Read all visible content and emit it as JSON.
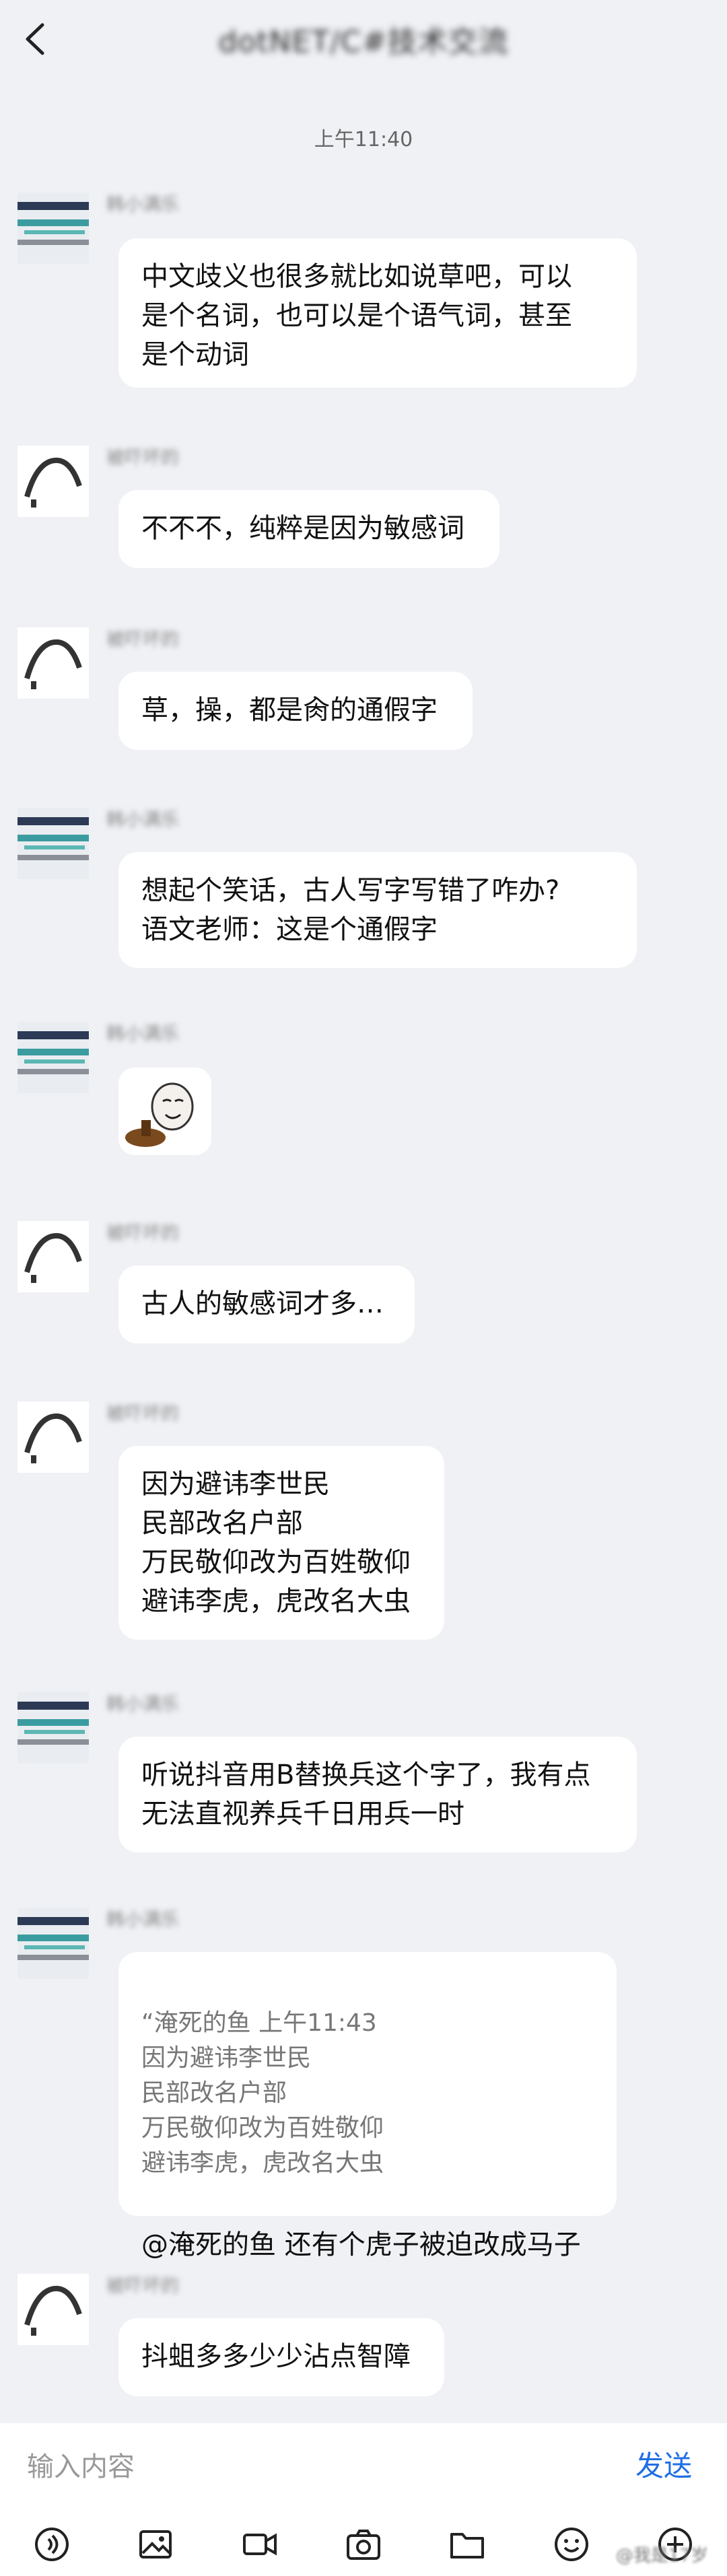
{
  "header": {
    "title": "dotNET/C#技术交流"
  },
  "time_divider": "上午11:40",
  "messages": [
    {
      "text": "中文歧义也很多就比如说草吧，可以\n是个名词，也可以是个语气词，甚至\n是个动词"
    },
    {
      "text": "不不不，纯粹是因为敏感词"
    },
    {
      "text": "草，操，都是肏的通假字"
    },
    {
      "text": "想起个笑话，古人写字写错了咋办?\n语文老师：这是个通假字"
    },
    {
      "text": "古人的敏感词才多…"
    },
    {
      "text": "因为避讳李世民\n民部改名户部\n万民敬仰改为百姓敬仰\n避讳李虎，虎改名大虫"
    },
    {
      "text": "听说抖音用B替换兵这个字了，我有点\n无法直视养兵千日用兵一时"
    },
    {
      "quote": "“淹死的鱼 上午11:43\n 因为避讳李世民\n民部改名户部\n万民敬仰改为百姓敬仰\n避讳李虎，虎改名大虫",
      "reply": "@淹死的鱼  还有个虎子被迫改成马子"
    },
    {
      "text": "抖蛆多多少少沾点智障"
    }
  ],
  "senders": {
    "a": "韩小满乐",
    "b": "被吓坏的"
  },
  "input": {
    "placeholder": "输入内容",
    "send_label": "发送"
  },
  "toolbar": [
    "voice-icon",
    "image-icon",
    "video-icon",
    "camera-icon",
    "folder-icon",
    "emoji-icon",
    "plus-icon"
  ],
  "watermark": "@我是17岁"
}
